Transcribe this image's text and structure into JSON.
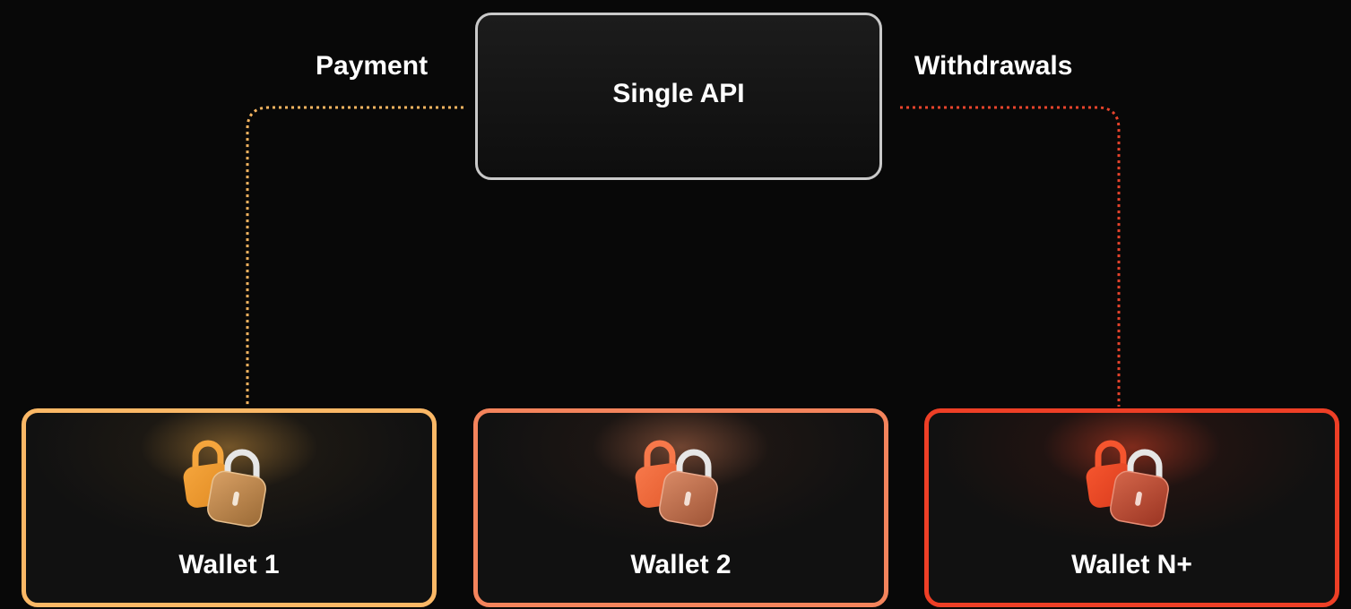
{
  "diagram": {
    "api_label": "Single API",
    "flows": {
      "payment": {
        "label": "Payment",
        "color": "#f6b560"
      },
      "withdrawals": {
        "label": "Withdrawals",
        "color": "#e8442c"
      }
    },
    "wallets": [
      {
        "label": "Wallet 1",
        "border_color": "#fbb866",
        "icon": "lock-icon"
      },
      {
        "label": "Wallet 2",
        "border_color": "#f4845c",
        "icon": "lock-icon"
      },
      {
        "label": "Wallet N+",
        "border_color": "#ee3f26",
        "icon": "lock-icon"
      }
    ],
    "background_color": "#080808"
  }
}
